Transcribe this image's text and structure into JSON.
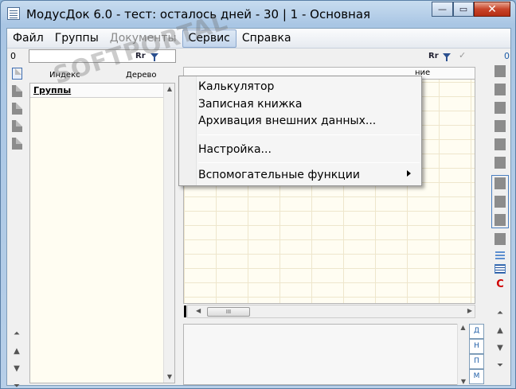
{
  "window": {
    "title": "МодусДок 6.0 - тест: осталось дней - 30 | 1 - Основная",
    "buttons": {
      "minimize": "—",
      "maximize": "▭",
      "close": "✕"
    }
  },
  "menubar": {
    "items": [
      {
        "label": "Файл",
        "state": "normal"
      },
      {
        "label": "Группы",
        "state": "normal"
      },
      {
        "label": "Документы",
        "state": "disabled"
      },
      {
        "label": "Сервис",
        "state": "active"
      },
      {
        "label": "Справка",
        "state": "normal"
      }
    ]
  },
  "dropdown": {
    "items": [
      {
        "label": "Калькулятор"
      },
      {
        "label": "Записная книжка"
      },
      {
        "label": "Архивация внешних данных..."
      },
      {
        "label": "Настройка..."
      },
      {
        "label": "Вспомогательные функции",
        "submenu": true
      }
    ]
  },
  "left_panel": {
    "counter": "0",
    "filter_rf": "Rr",
    "tabs": [
      {
        "label": "Индекс"
      },
      {
        "label": "Дерево"
      }
    ],
    "groups_header": "Группы"
  },
  "right_panel": {
    "counter": "0",
    "filter_rf": "Rr",
    "grid_column_partial": "ние",
    "hscroll_thumb": "III",
    "side_tabs": [
      "Д",
      "Н",
      "П",
      "М"
    ],
    "red_c": "С"
  },
  "watermark": "SOFTPORTAL",
  "colors": {
    "window_frame": "#a9c6e4",
    "close_button": "#c8442a",
    "grid_background": "#fffdf2",
    "accent_blue": "#1f5ea8",
    "red_c": "#d00000"
  }
}
